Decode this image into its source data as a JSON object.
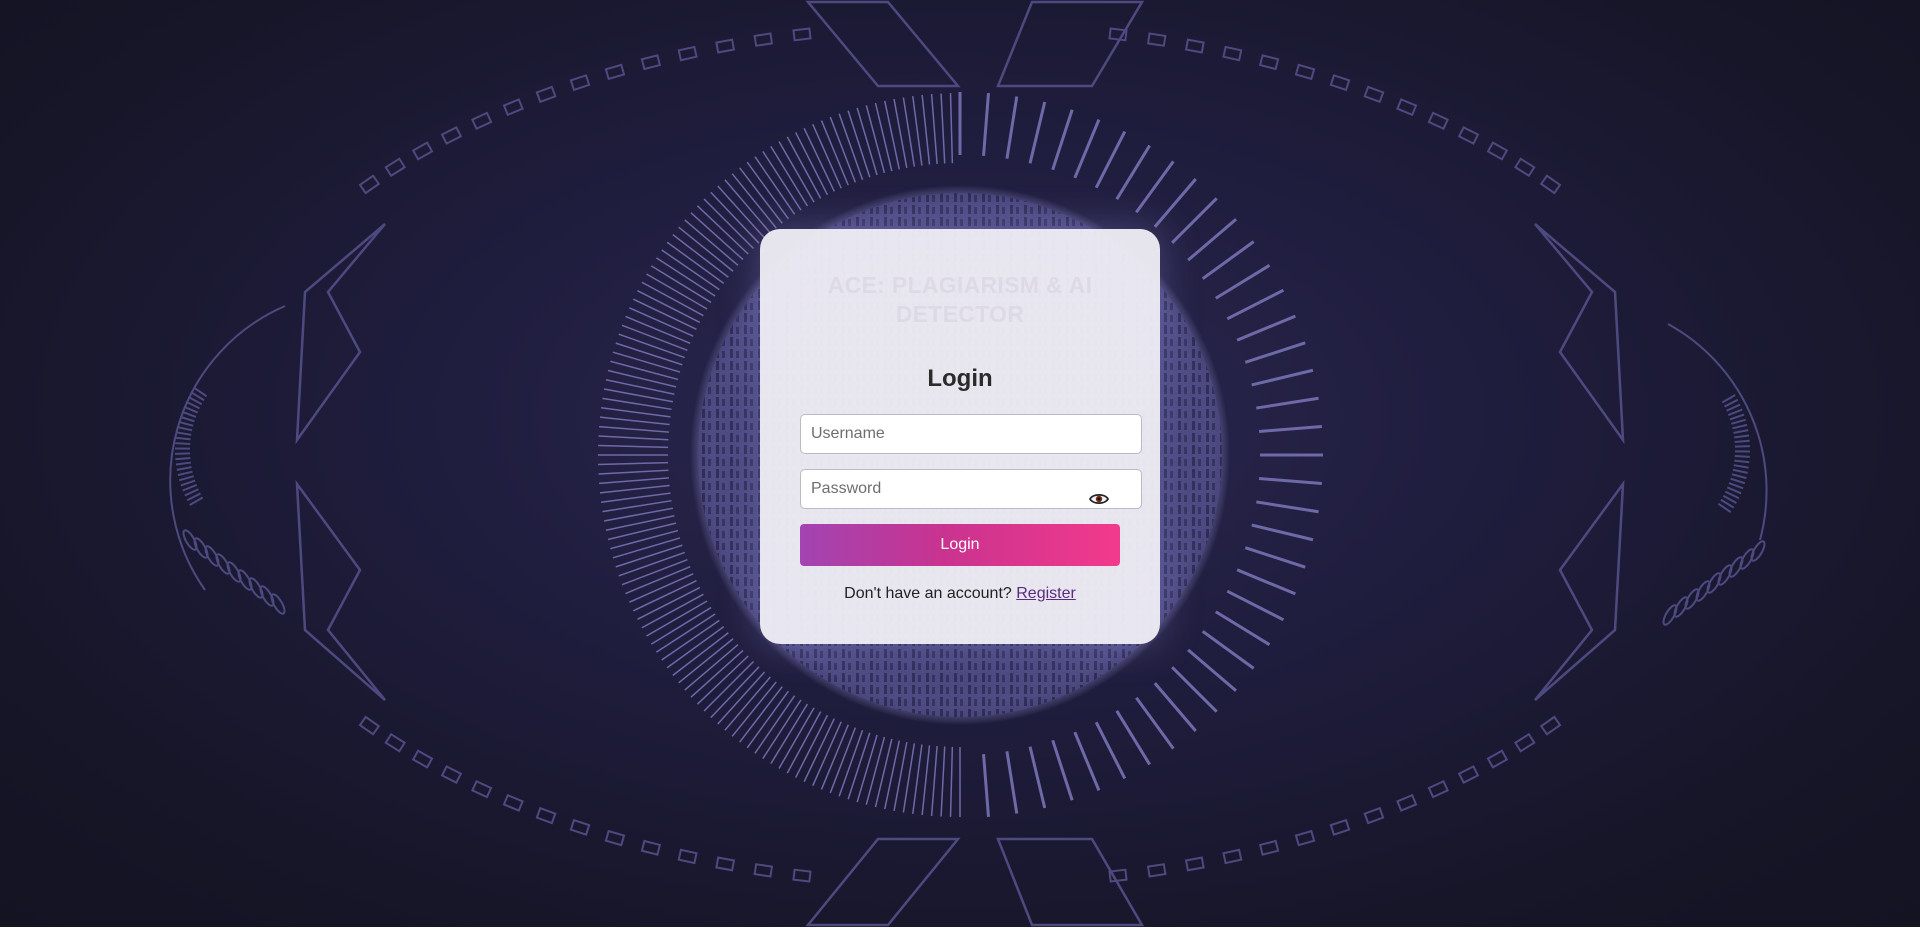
{
  "app": {
    "title": "ACE: PLAGIARISM & AI DETECTOR"
  },
  "login": {
    "heading": "Login",
    "username_placeholder": "Username",
    "password_placeholder": "Password",
    "submit_label": "Login",
    "register_prompt": "Don't have an account?",
    "register_link": "Register"
  },
  "icons": {
    "password_toggle": "eye-icon"
  },
  "colors": {
    "background": "#1f1d3d",
    "decor_stroke": "#4d4a80",
    "ring": "#6e6aa8",
    "card": "#f2f0f6",
    "button_start": "#a244b2",
    "button_end": "#f23a8c",
    "link": "#5a2a80"
  }
}
